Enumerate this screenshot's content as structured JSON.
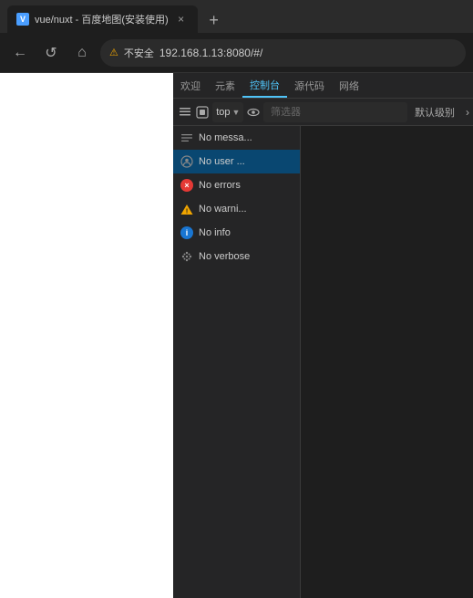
{
  "browser": {
    "tab": {
      "favicon_text": "V",
      "title": "vue/nuxt - 百度地图(安装使用)",
      "close_label": "×"
    },
    "new_tab_label": "+",
    "nav": {
      "back_label": "←",
      "forward_label": "→",
      "home_label": "⌂",
      "refresh_label": "↺"
    },
    "address": {
      "security_label": "不安全",
      "url": "192.168.1.13:8080/#/"
    }
  },
  "devtools": {
    "tabs": [
      {
        "label": "欢迎",
        "active": false
      },
      {
        "label": "元素",
        "active": false
      },
      {
        "label": "控制台",
        "active": true
      },
      {
        "label": "源代码",
        "active": false
      },
      {
        "label": "网络",
        "active": false
      }
    ],
    "toolbar": {
      "clear_icon": "🚫",
      "context_icon": "⊡",
      "context_dropdown": "top",
      "eye_icon": "👁",
      "filter_placeholder": "筛选器",
      "level_label": "默认级别",
      "chevron": "›"
    },
    "log_items": [
      {
        "type": "message",
        "icon_type": "message",
        "icon_char": "≡",
        "label": "No messa..."
      },
      {
        "type": "user",
        "icon_type": "user",
        "icon_char": "⊙",
        "label": "No user ..."
      },
      {
        "type": "error",
        "icon_type": "error",
        "icon_char": "×",
        "label": "No errors"
      },
      {
        "type": "warning",
        "icon_type": "warning",
        "icon_char": "!",
        "label": "No warni..."
      },
      {
        "type": "info",
        "icon_type": "info",
        "icon_char": "i",
        "label": "No info"
      },
      {
        "type": "verbose",
        "icon_type": "verbose",
        "icon_char": "✳",
        "label": "No verbose"
      }
    ]
  }
}
